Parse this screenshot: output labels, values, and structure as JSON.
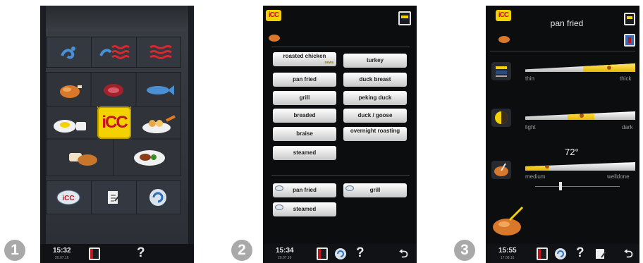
{
  "steps": [
    "1",
    "2",
    "3"
  ],
  "screen1": {
    "logo": "iCC",
    "statusbar": {
      "time": "15:32",
      "date": "20.07.16",
      "help": "?"
    }
  },
  "screen2": {
    "logo": "iCC",
    "menu_left": [
      "pan fried",
      "grill",
      "breaded",
      "braise",
      "steamed"
    ],
    "roasted_chicken": "roasted chicken",
    "roasted_chicken_badge": "news",
    "menu_right": [
      "turkey",
      "duck breast",
      "peking duck",
      "duck / goose",
      "overnight roasting"
    ],
    "recent": [
      "pan fried",
      "grill",
      "steamed"
    ],
    "statusbar": {
      "time": "15:34",
      "date": "20.07.16",
      "help": "?",
      "back": "⮌"
    }
  },
  "screen3": {
    "logo": "iCC",
    "title": "pan fried",
    "thickness": {
      "min": "thin",
      "max": "thick"
    },
    "browning": {
      "min": "light",
      "max": "dark"
    },
    "core_temp": "72°",
    "doneness": {
      "min": "medium",
      "max": "welldone"
    },
    "statusbar": {
      "time": "15:55",
      "date": "17.08.16",
      "help": "?",
      "back": "⮌"
    }
  },
  "colors": {
    "icc_yellow": "#f4d100",
    "icc_red": "#c4151c",
    "slider_fill": "#e8b800"
  }
}
